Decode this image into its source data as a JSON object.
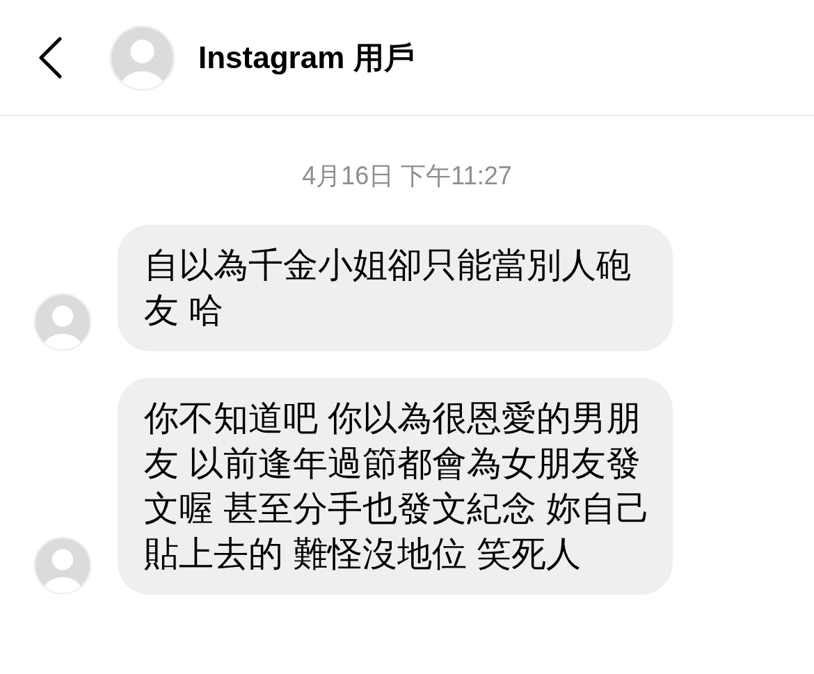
{
  "header": {
    "title": "Instagram 用戶"
  },
  "timestamp": "4月16日 下午11:27",
  "messages": [
    {
      "text": "自以為千金小姐卻只能當別人砲友 哈"
    },
    {
      "text": "你不知道吧 你以為很恩愛的男朋友 以前逢年過節都會為女朋友發文喔 甚至分手也發文紀念 妳自己貼上去的 難怪沒地位 笑死人"
    }
  ]
}
